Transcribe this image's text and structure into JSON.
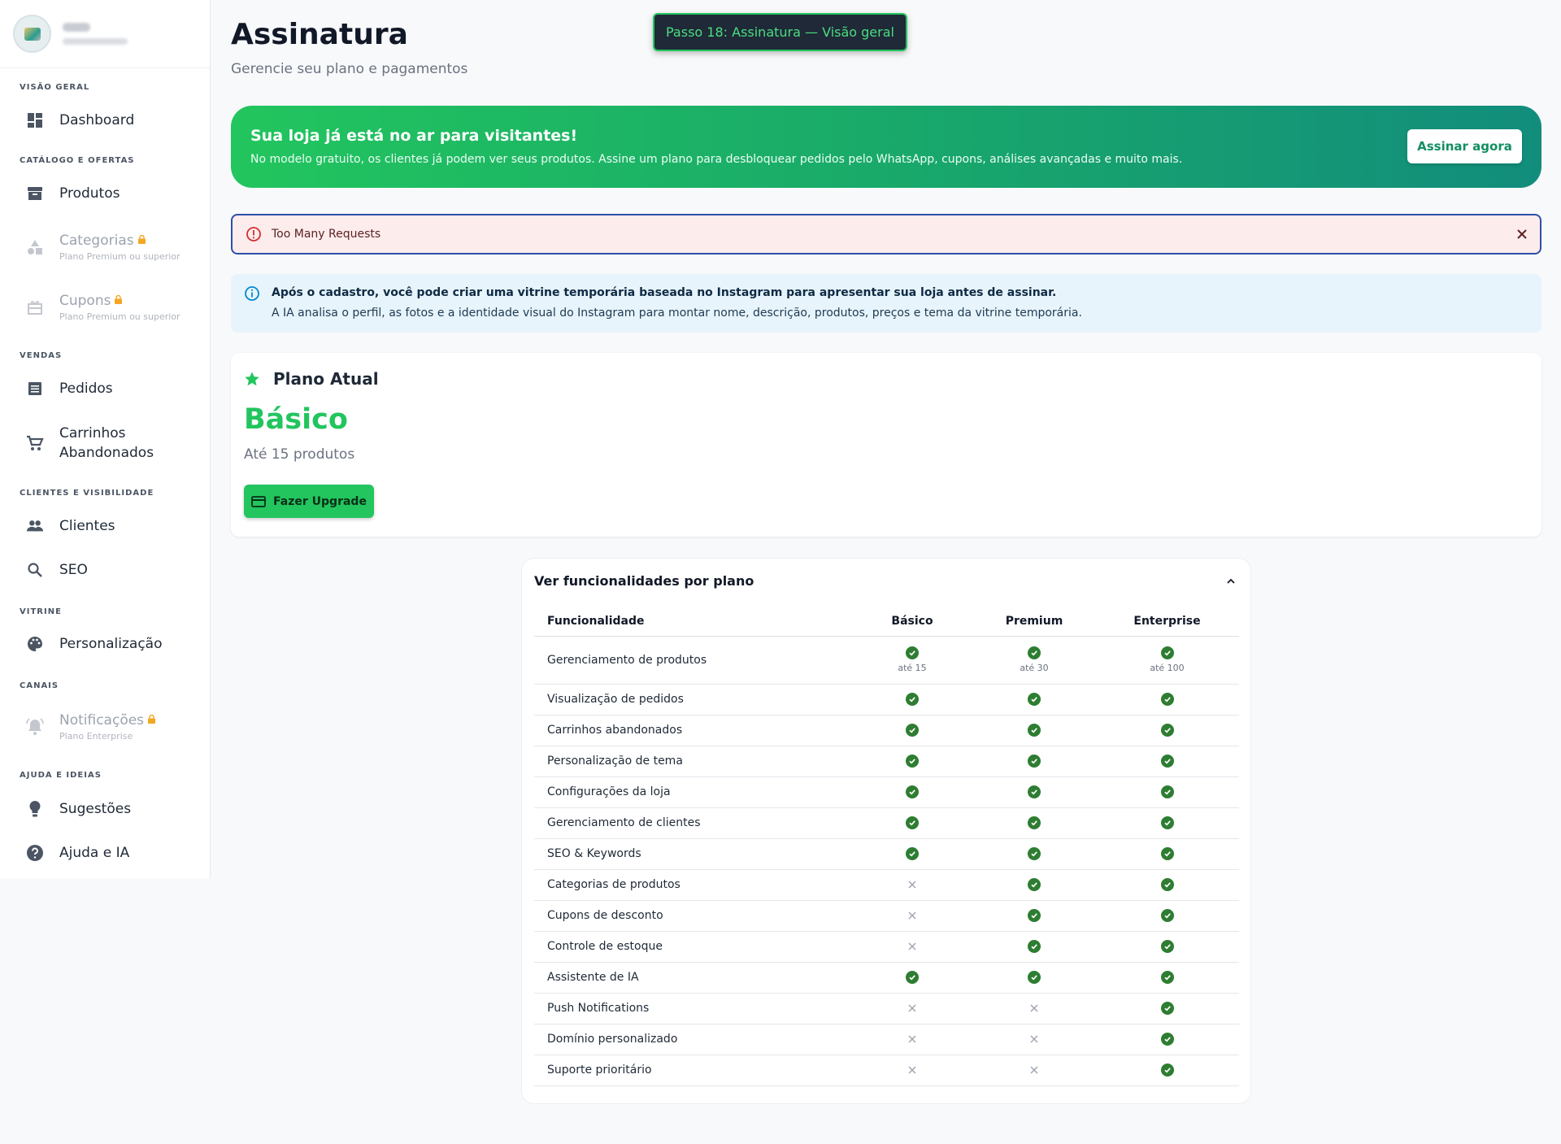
{
  "sidebar": {
    "sections": {
      "overview": "VISÃO GERAL",
      "catalog": "CATÁLOGO E OFERTAS",
      "sales": "VENDAS",
      "clients": "CLIENTES E VISIBILIDADE",
      "showcase": "VITRINE",
      "channels": "CANAIS",
      "help": "AJUDA E IDEIAS"
    },
    "items": {
      "dashboard": "Dashboard",
      "products": "Produtos",
      "categories": "Categorias",
      "categories_sub": "Plano Premium ou superior",
      "coupons": "Cupons",
      "coupons_sub": "Plano Premium ou superior",
      "orders": "Pedidos",
      "carts_line1": "Carrinhos",
      "carts_line2": "Abandonados",
      "clients": "Clientes",
      "seo": "SEO",
      "customization": "Personalização",
      "notifications": "Notificações",
      "notifications_sub": "Plano Enterprise",
      "suggestions": "Sugestões",
      "help_ai": "Ajuda e IA"
    }
  },
  "header": {
    "title": "Assinatura",
    "subtitle": "Gerencie seu plano e pagamentos",
    "step_badge": "Passo 18: Assinatura — Visão geral"
  },
  "hero": {
    "title": "Sua loja já está no ar para visitantes!",
    "text": "No modelo gratuito, os clientes já podem ver seus produtos. Assine um plano para desbloquear pedidos pelo WhatsApp, cupons, análises avançadas e muito mais.",
    "button": "Assinar agora"
  },
  "alert": {
    "text": "Too Many Requests"
  },
  "info": {
    "bold": "Após o cadastro, você pode criar uma vitrine temporária baseada no Instagram para apresentar sua loja antes de assinar.",
    "text": "A IA analisa o perfil, as fotos e a identidade visual do Instagram para montar nome, descrição, produtos, preços e tema da vitrine temporária."
  },
  "plan": {
    "heading": "Plano Atual",
    "name": "Básico",
    "limit": "Até 15 produtos",
    "upgrade_button": "Fazer Upgrade"
  },
  "features": {
    "title": "Ver funcionalidades por plano",
    "headers": [
      "Funcionalidade",
      "Básico",
      "Premium",
      "Enterprise"
    ],
    "rows": [
      {
        "name": "Gerenciamento de produtos",
        "basic": true,
        "premium": true,
        "enterprise": true,
        "notes": [
          "até 15",
          "até 30",
          "até 100"
        ]
      },
      {
        "name": "Visualização de pedidos",
        "basic": true,
        "premium": true,
        "enterprise": true
      },
      {
        "name": "Carrinhos abandonados",
        "basic": true,
        "premium": true,
        "enterprise": true
      },
      {
        "name": "Personalização de tema",
        "basic": true,
        "premium": true,
        "enterprise": true
      },
      {
        "name": "Configurações da loja",
        "basic": true,
        "premium": true,
        "enterprise": true
      },
      {
        "name": "Gerenciamento de clientes",
        "basic": true,
        "premium": true,
        "enterprise": true
      },
      {
        "name": "SEO & Keywords",
        "basic": true,
        "premium": true,
        "enterprise": true
      },
      {
        "name": "Categorias de produtos",
        "basic": false,
        "premium": true,
        "enterprise": true
      },
      {
        "name": "Cupons de desconto",
        "basic": false,
        "premium": true,
        "enterprise": true
      },
      {
        "name": "Controle de estoque",
        "basic": false,
        "premium": true,
        "enterprise": true
      },
      {
        "name": "Assistente de IA",
        "basic": true,
        "premium": true,
        "enterprise": true
      },
      {
        "name": "Push Notifications",
        "basic": false,
        "premium": false,
        "enterprise": true
      },
      {
        "name": "Domínio personalizado",
        "basic": false,
        "premium": false,
        "enterprise": true
      },
      {
        "name": "Suporte prioritário",
        "basic": false,
        "premium": false,
        "enterprise": true
      }
    ]
  },
  "colors": {
    "accent": "#22c55e",
    "check": "#2e7d32",
    "lock": "#f5a623",
    "alert_bg": "#fdecec",
    "info_bg": "#e7f4fb"
  }
}
